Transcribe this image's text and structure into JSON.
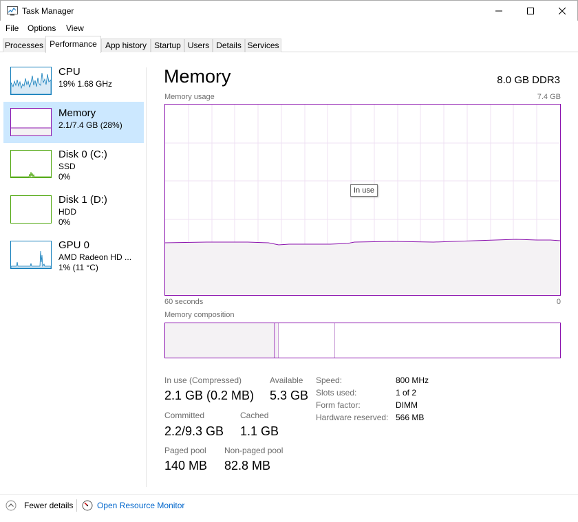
{
  "window": {
    "title": "Task Manager",
    "icon": "task-manager-icon",
    "controls": [
      "minimize-icon",
      "maximize-icon",
      "close-icon"
    ]
  },
  "menu": [
    "File",
    "Options",
    "View"
  ],
  "tabs": [
    {
      "label": "Processes",
      "active": false
    },
    {
      "label": "Performance",
      "active": true
    },
    {
      "label": "App history",
      "active": false
    },
    {
      "label": "Startup",
      "active": false
    },
    {
      "label": "Users",
      "active": false
    },
    {
      "label": "Details",
      "active": false
    },
    {
      "label": "Services",
      "active": false
    }
  ],
  "sidebar": {
    "items": [
      {
        "title": "CPU",
        "line1": "19% 1.68 GHz",
        "line2": "",
        "color": "#117dbb",
        "active": false
      },
      {
        "title": "Memory",
        "line1": "2.1/7.4 GB (28%)",
        "line2": "",
        "color": "#8b12ae",
        "active": true
      },
      {
        "title": "Disk 0 (C:)",
        "line1": "SSD",
        "line2": "0%",
        "color": "#4da60c",
        "active": false
      },
      {
        "title": "Disk 1 (D:)",
        "line1": "HDD",
        "line2": "0%",
        "color": "#4da60c",
        "active": false
      },
      {
        "title": "GPU 0",
        "line1": "AMD Radeon HD ...",
        "line2": "1% (11 °C)",
        "color": "#117dbb",
        "active": false
      }
    ]
  },
  "main": {
    "title": "Memory",
    "spec": "8.0 GB DDR3",
    "usage_label": "Memory usage",
    "usage_max": "7.4 GB",
    "time_left": "60 seconds",
    "time_right": "0",
    "tooltip": "In use",
    "composition_label": "Memory composition",
    "accent": "#8b12ae",
    "in_use_fraction": 0.28
  },
  "stats": {
    "in_use_label": "In use (Compressed)",
    "in_use_value": "2.1 GB (0.2 MB)",
    "available_label": "Available",
    "available_value": "5.3 GB",
    "committed_label": "Committed",
    "committed_value": "2.2/9.3 GB",
    "cached_label": "Cached",
    "cached_value": "1.1 GB",
    "paged_label": "Paged pool",
    "paged_value": "140 MB",
    "nonpaged_label": "Non-paged pool",
    "nonpaged_value": "82.8 MB"
  },
  "info": [
    {
      "label": "Speed:",
      "value": "800 MHz"
    },
    {
      "label": "Slots used:",
      "value": "1 of 2"
    },
    {
      "label": "Form factor:",
      "value": "DIMM"
    },
    {
      "label": "Hardware reserved:",
      "value": "566 MB"
    }
  ],
  "footer": {
    "fewer_details": "Fewer details",
    "resource_monitor": "Open Resource Monitor"
  }
}
